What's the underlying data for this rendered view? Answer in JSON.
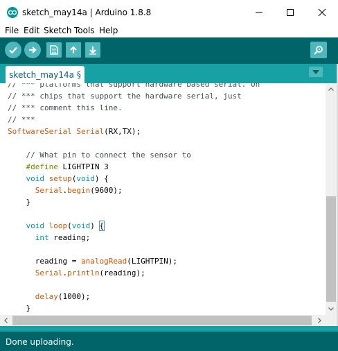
{
  "window": {
    "title": "sketch_may14a | Arduino 1.8.8"
  },
  "menu": {
    "items": [
      "File",
      "Edit",
      "Sketch",
      "Tools",
      "Help"
    ]
  },
  "toolbar": {
    "buttons": [
      "verify-icon",
      "upload-icon",
      "new-icon",
      "open-icon",
      "save-icon",
      "serial-monitor-icon"
    ]
  },
  "tabs": {
    "active_label": "sketch_may14a §"
  },
  "editor": {
    "lines": [
      "// *** platforms that support hardware based serial. On",
      "// *** chips that support the hardware serial, just",
      "// *** comment this line.",
      "// ***",
      "SoftwareSerial Serial(RX,TX);",
      "",
      "    // What pin to connect the sensor to",
      "    #define LIGHTPIN 3",
      "    void setup(void) {",
      "      Serial.begin(9600);",
      "    }",
      "",
      "    void loop(void) {",
      "      int reading;",
      "",
      "      reading = analogRead(LIGHTPIN);",
      "      Serial.println(reading);",
      "",
      "      delay(1000);",
      "    }"
    ]
  },
  "status": {
    "text": "Done uploading."
  },
  "colors": {
    "toolbar_bg": "#006468",
    "tabbar_bg": "#17a1a5",
    "keyword_orange": "#d35400",
    "keyword_blue": "#00979c",
    "keyword_green": "#728e00"
  }
}
